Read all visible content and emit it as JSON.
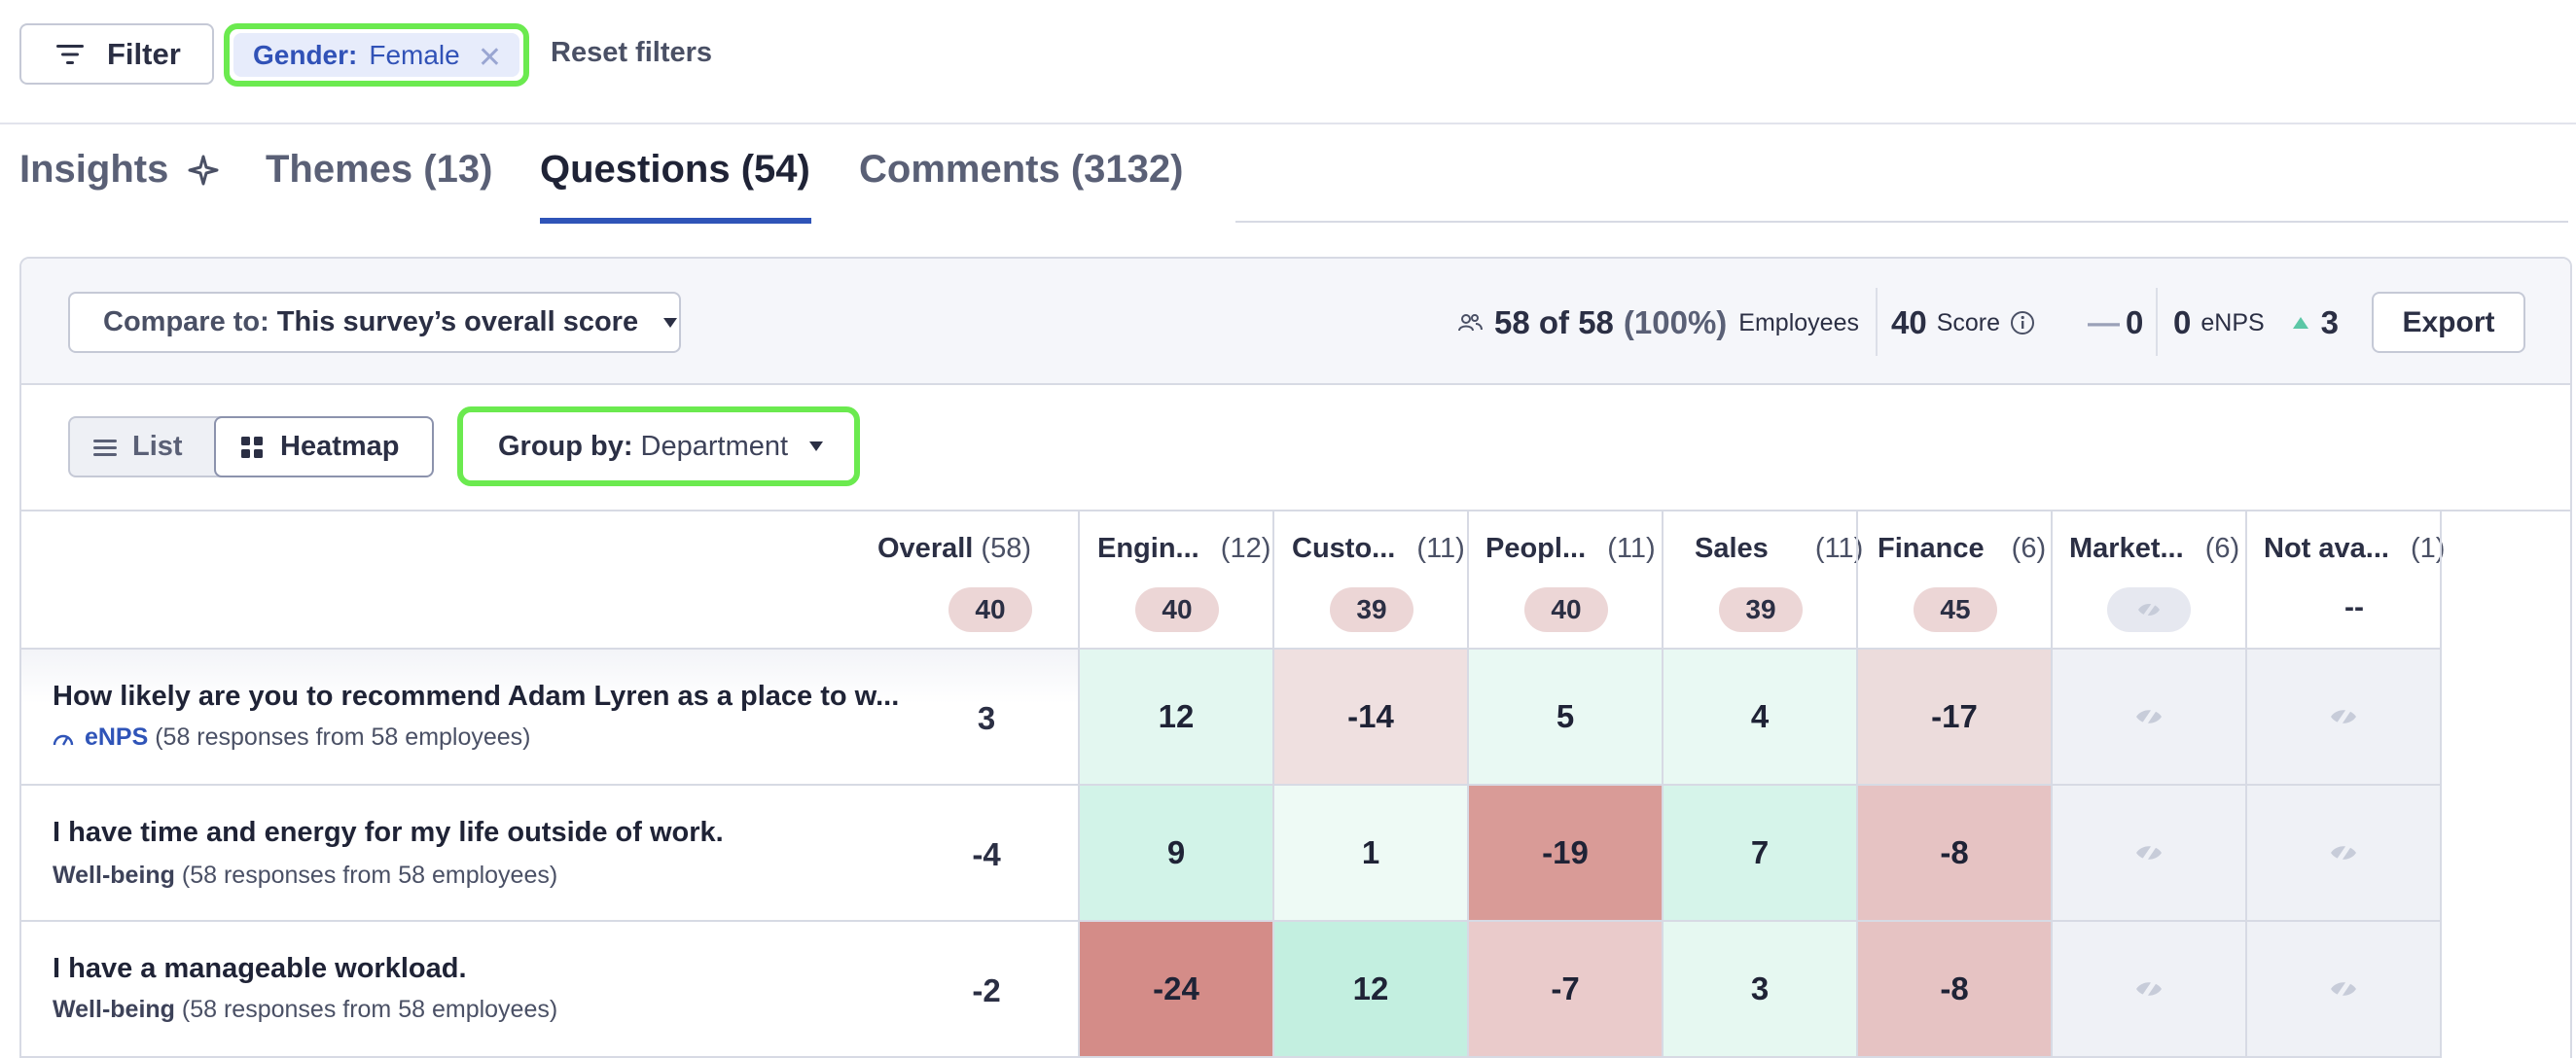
{
  "filterbar": {
    "filter_label": "Filter",
    "chip_key": "Gender:",
    "chip_value": "Female",
    "reset_label": "Reset filters"
  },
  "tabs": [
    {
      "label": "Insights"
    },
    {
      "label": "Themes (13)"
    },
    {
      "label": "Questions (54)"
    },
    {
      "label": "Comments (3132)"
    }
  ],
  "toolbar": {
    "compare_label": "Compare to:",
    "compare_value": "This survey’s overall score",
    "employees_count": "58 of 58",
    "employees_pct": "(100%)",
    "employees_label": "Employees",
    "score_value": "40",
    "score_label": "Score",
    "change_value": "0",
    "enps_value": "0",
    "enps_label": "eNPS",
    "trend_value": "3",
    "export_label": "Export"
  },
  "view": {
    "list_label": "List",
    "heatmap_label": "Heatmap",
    "group_label": "Group by:",
    "group_value": "Department"
  },
  "columns": [
    {
      "name": "Overall",
      "count": "(58)",
      "score": "40"
    },
    {
      "name": "Engin...",
      "count": "(12)",
      "score": "40"
    },
    {
      "name": "Custo...",
      "count": "(11)",
      "score": "39"
    },
    {
      "name": "Peopl...",
      "count": "(11)",
      "score": "40"
    },
    {
      "name": "Sales",
      "count": "(11)",
      "score": "39"
    },
    {
      "name": "Finance",
      "count": "(6)",
      "score": "45"
    },
    {
      "name": "Market...",
      "count": "(6)",
      "score": ""
    },
    {
      "name": "Not ava...",
      "count": "(1)",
      "score": "--"
    }
  ],
  "rows": [
    {
      "question": "How likely are you to recommend Adam Lyren as a place to w...",
      "category": "eNPS",
      "responses": "(58 responses from 58 employees)",
      "overall": "3",
      "values": [
        "12",
        "-14",
        "5",
        "4",
        "-17"
      ]
    },
    {
      "question": "I have time and energy for my life outside of work.",
      "category": "Well-being",
      "responses": "(58 responses from 58 employees)",
      "overall": "-4",
      "values": [
        "9",
        "1",
        "-19",
        "7",
        "-8"
      ]
    },
    {
      "question": "I have a manageable workload.",
      "category": "Well-being",
      "responses": "(58 responses from 58 employees)",
      "overall": "-2",
      "values": [
        "-24",
        "12",
        "-7",
        "3",
        "-8"
      ]
    }
  ],
  "colors": {
    "accent": "#2f54b8",
    "highlight": "#6bea4f",
    "positive_strong": "#c5efe2",
    "positive_light": "#e6f8f1",
    "negative_light": "#efe0e0",
    "negative_mid": "#e7c6c6",
    "negative_strong": "#d79a97"
  }
}
